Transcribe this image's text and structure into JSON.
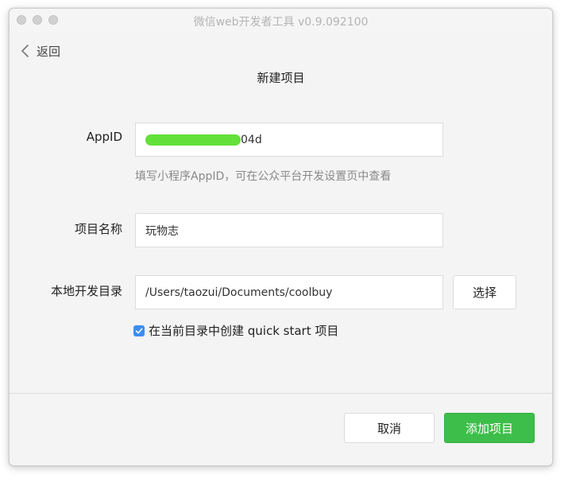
{
  "window": {
    "title": "微信web开发者工具 v0.9.092100"
  },
  "nav": {
    "back_label": "返回"
  },
  "page": {
    "title": "新建项目"
  },
  "form": {
    "appid": {
      "label": "AppID",
      "value_visible_suffix": "04d",
      "hint": "填写小程序AppID，可在公众平台开发设置页中查看"
    },
    "project_name": {
      "label": "项目名称",
      "value": "玩物志"
    },
    "local_dir": {
      "label": "本地开发目录",
      "value": "/Users/taozui/Documents/coolbuy",
      "choose_label": "选择"
    },
    "quick_start": {
      "checked": true,
      "label": "在当前目录中创建 quick start 项目"
    }
  },
  "footer": {
    "cancel_label": "取消",
    "add_label": "添加项目"
  },
  "colors": {
    "accent_green": "#3dbe4a",
    "checkbox_blue": "#3b8ef0",
    "redaction_green": "#63e039"
  }
}
